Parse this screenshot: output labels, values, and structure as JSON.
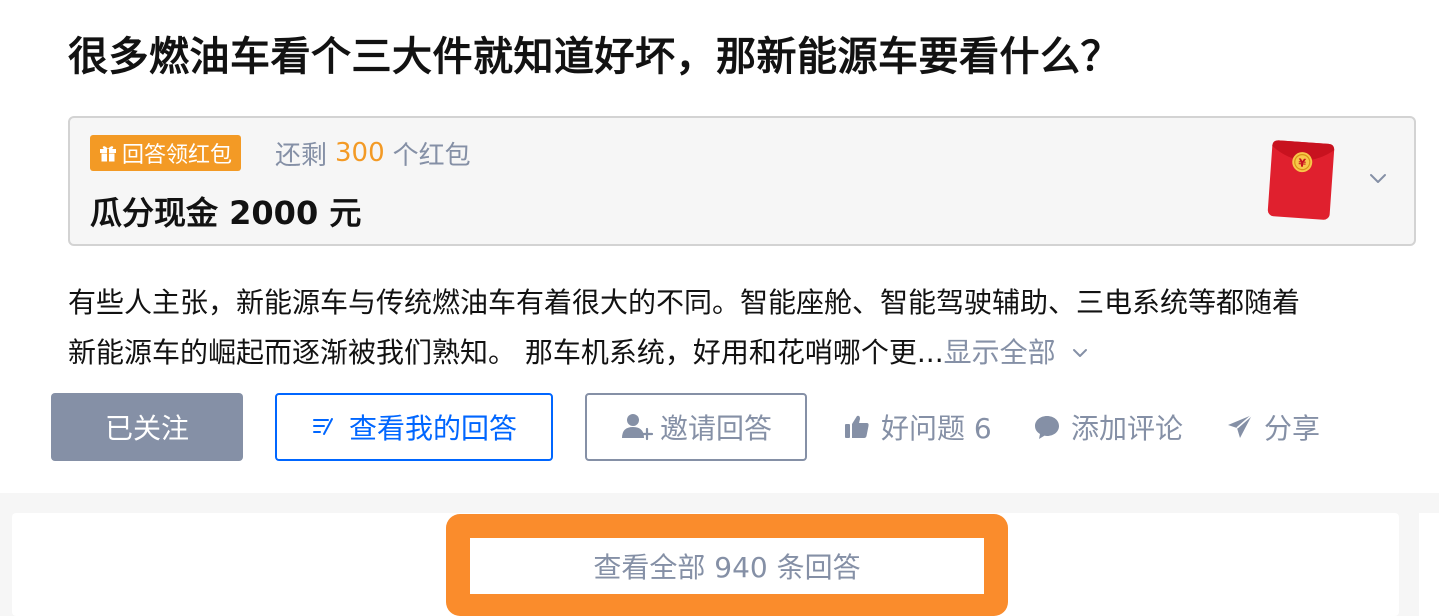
{
  "question": {
    "title": "很多燃油车看个三大件就知道好坏，那新能源车要看什么？"
  },
  "reward": {
    "tag_label": "回答领红包",
    "tag_icon": "gift-icon",
    "remain_prefix": "还剩",
    "remain_count": "300",
    "remain_suffix": "个红包",
    "amount_text": "瓜分现金 2000 元",
    "envelope_icon": "red-envelope-icon",
    "expand_icon": "chevron-down-icon"
  },
  "detail": {
    "line1": "有些人主张，新能源车与传统燃油车有着很大的不同。智能座舱、智能驾驶辅助、三电系统等都随着",
    "line2": "新能源车的崛起而逐渐被我们熟知。 那车机系统，好用和花哨哪个更...",
    "show_all_label": "显示全部"
  },
  "actions": {
    "followed_label": "已关注",
    "my_answer_label": "查看我的回答",
    "invite_label": "邀请回答",
    "good_question_label": "好问题 6",
    "comment_label": "添加评论",
    "share_label": "分享"
  },
  "answers": {
    "view_all_label": "查看全部 940 条回答"
  },
  "colors": {
    "brand_blue": "#0066ff",
    "muted_gray": "#8590a6",
    "reward_orange": "#f39a25",
    "highlight_orange": "#fa8c2c",
    "envelope_red": "#e0202e"
  }
}
